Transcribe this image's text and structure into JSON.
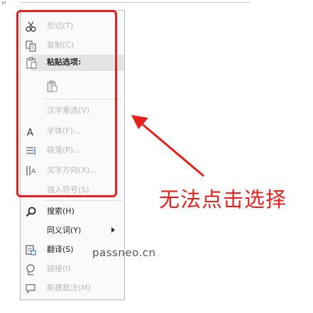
{
  "context_menu": {
    "items": [
      {
        "label": "剪切(T)",
        "icon": "scissors-icon",
        "enabled": false
      },
      {
        "label": "复制(C)",
        "icon": "copy-icon",
        "enabled": false
      },
      {
        "label": "粘贴选项:",
        "icon": "paste-icon",
        "enabled": true,
        "header": true
      },
      {
        "label": "",
        "icon": "paste-keep-format-icon",
        "enabled": false
      },
      {
        "label": "汉字重选(V)",
        "icon": "",
        "enabled": false
      },
      {
        "label": "字体(F)...",
        "icon": "font-a-icon",
        "enabled": false
      },
      {
        "label": "段落(P)...",
        "icon": "paragraph-icon",
        "enabled": false
      },
      {
        "label": "文字方向(X)...",
        "icon": "text-direction-icon",
        "enabled": false
      },
      {
        "label": "插入符号(S)",
        "icon": "",
        "enabled": false
      },
      {
        "label": "搜索(H)",
        "icon": "search-icon",
        "enabled": true
      },
      {
        "label": "同义词(Y)",
        "icon": "",
        "enabled": true,
        "submenu": true
      },
      {
        "label": "翻译(S)",
        "icon": "translate-icon",
        "enabled": true
      },
      {
        "label": "链接(I)",
        "icon": "link-icon",
        "enabled": false
      },
      {
        "label": "新建批注(M)",
        "icon": "new-comment-icon",
        "enabled": false
      }
    ]
  },
  "annotation": {
    "caption": "无法点击选择",
    "color": "#e8201c"
  },
  "watermark": "passneo.cn"
}
